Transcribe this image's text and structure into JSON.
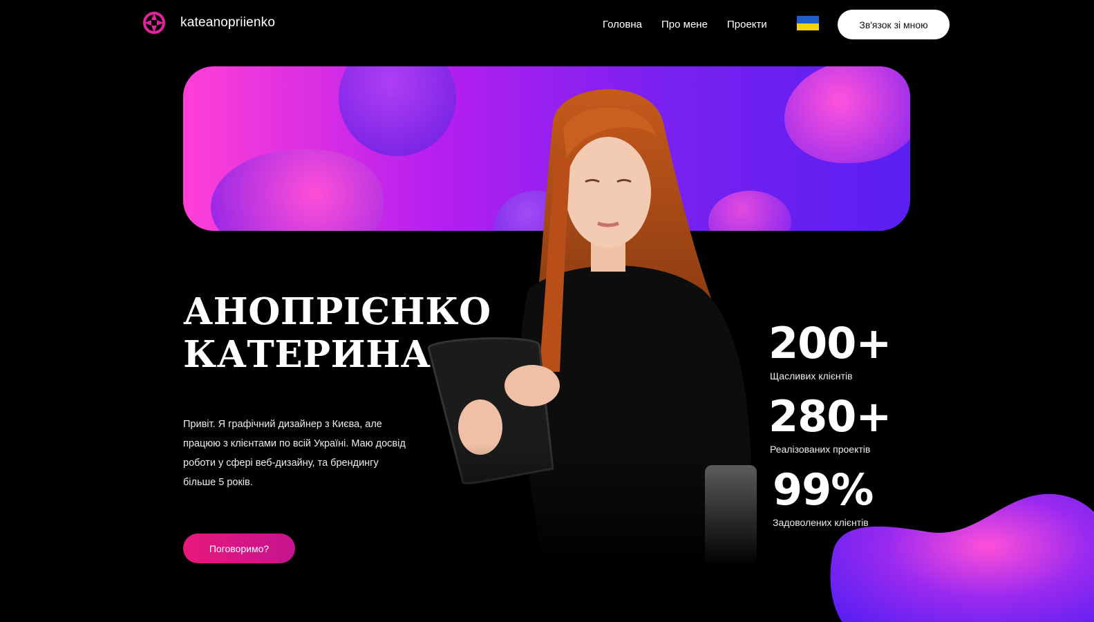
{
  "header": {
    "logo_text": "kateanopriienko",
    "nav": [
      {
        "label": "Головна"
      },
      {
        "label": "Про мене"
      },
      {
        "label": "Проекти"
      }
    ],
    "contact_button": "Зв'язок зі мною"
  },
  "hero": {
    "title_line1": "АНОПРІЄНКО",
    "title_line2": "КАТЕРИНА",
    "description": "Привіт. Я графічний дизайнер з Києва, але працюю з клієнтами по всій Україні. Маю досвід роботи у сфері веб-дизайну, та брендингу більше 5 років.",
    "cta": "Поговоримо?"
  },
  "stats": [
    {
      "value": "200+",
      "label": "Щасливих клієнтів"
    },
    {
      "value": "280+",
      "label": "Реалізованих проектів"
    },
    {
      "value": "99%",
      "label": "Задоволених клієнтів"
    }
  ],
  "colors": {
    "accent_pink": "#e8197c",
    "banner_gradient_start": "#ff3fd6",
    "banner_gradient_end": "#5a1ff2",
    "background": "#000000"
  },
  "icons": {
    "logo": "aperture-icon",
    "language": "ukraine-flag-icon"
  }
}
